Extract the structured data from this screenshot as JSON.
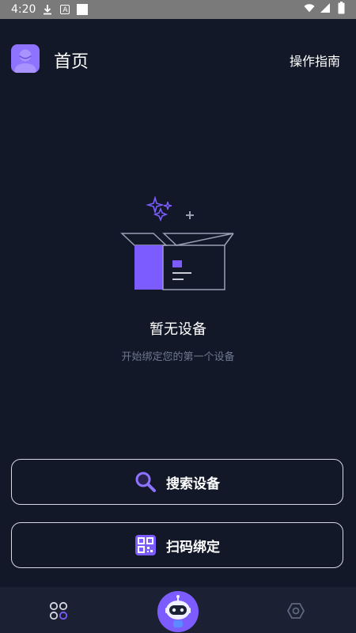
{
  "status_bar": {
    "time": "4:20",
    "icons": [
      "download-icon",
      "a-notification-icon",
      "white-square-icon",
      "wifi-icon",
      "signal-icon",
      "battery-icon"
    ]
  },
  "header": {
    "title": "首页",
    "guide_link": "操作指南",
    "avatar_color": "#8d73ff"
  },
  "empty_state": {
    "title": "暂无设备",
    "subtitle": "开始绑定您的第一个设备"
  },
  "actions": {
    "search_label": "搜索设备",
    "scan_label": "扫码绑定"
  },
  "bottom_nav": {
    "items": [
      {
        "icon": "grid-home-icon",
        "active": true
      },
      {
        "icon": "robot-assistant-icon",
        "active": false
      },
      {
        "icon": "hexagon-settings-icon",
        "active": false
      }
    ]
  },
  "colors": {
    "background": "#121828",
    "accent": "#7c5cff",
    "nav_background": "#1b2133"
  }
}
